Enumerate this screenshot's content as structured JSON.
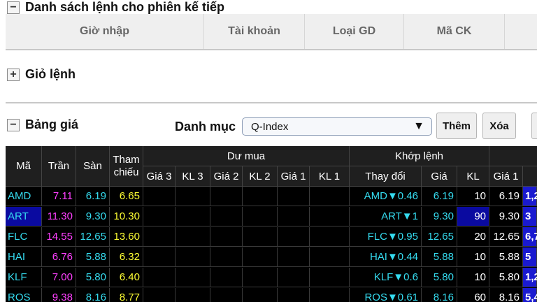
{
  "section_next": {
    "toggle": "−",
    "title": "Danh sách lệnh cho phiên kế tiếp",
    "columns": [
      "Giờ nhập",
      "Tài khoản",
      "Loại GD",
      "Mã CK"
    ]
  },
  "section_basket": {
    "toggle": "+",
    "title": "Giỏ lệnh"
  },
  "section_board": {
    "toggle": "−",
    "title": "Bảng giá",
    "category_label": "Danh mục",
    "category_value": "Q-Index",
    "select_arrow": "▼",
    "add_label": "Thêm",
    "delete_label": "Xóa"
  },
  "board": {
    "headers": {
      "symbol": "Mã",
      "ceiling": "Trần",
      "floor": "Sàn",
      "reference": "Tham chiếu",
      "bid_group": "Dư mua",
      "bid_cols": [
        "Giá 3",
        "KL 3",
        "Giá 2",
        "KL 2",
        "Giá 1",
        "KL 1"
      ],
      "match_group": "Khớp lệnh",
      "match_cols": [
        "Thay đổi",
        "Giá",
        "KL"
      ],
      "ask_price1": "Giá 1"
    },
    "rows": [
      {
        "symbol": "AMD",
        "ceiling": "7.11",
        "floor": "6.19",
        "ref": "6.65",
        "change": "AMD▼0.46",
        "price": "6.19",
        "volume": "10",
        "ask1": "6.19",
        "extra": "1,2",
        "selected": false,
        "vol_highlight": false
      },
      {
        "symbol": "ART",
        "ceiling": "11.30",
        "floor": "9.30",
        "ref": "10.30",
        "change": "ART▼1",
        "price": "9.30",
        "volume": "90",
        "ask1": "9.30",
        "extra": "3",
        "selected": true,
        "vol_highlight": true
      },
      {
        "symbol": "FLC",
        "ceiling": "14.55",
        "floor": "12.65",
        "ref": "13.60",
        "change": "FLC▼0.95",
        "price": "12.65",
        "volume": "20",
        "ask1": "12.65",
        "extra": "6,7",
        "selected": false,
        "vol_highlight": false
      },
      {
        "symbol": "HAI",
        "ceiling": "6.76",
        "floor": "5.88",
        "ref": "6.32",
        "change": "HAI▼0.44",
        "price": "5.88",
        "volume": "10",
        "ask1": "5.88",
        "extra": "5",
        "selected": false,
        "vol_highlight": false
      },
      {
        "symbol": "KLF",
        "ceiling": "7.00",
        "floor": "5.80",
        "ref": "6.40",
        "change": "KLF▼0.6",
        "price": "5.80",
        "volume": "10",
        "ask1": "5.80",
        "extra": "1,2",
        "selected": false,
        "vol_highlight": false
      },
      {
        "symbol": "ROS",
        "ceiling": "9.38",
        "floor": "8.16",
        "ref": "8.77",
        "change": "ROS▼0.61",
        "price": "8.16",
        "volume": "60",
        "ask1": "8.16",
        "extra": "5,4",
        "selected": false,
        "vol_highlight": false
      }
    ]
  },
  "colors": {
    "ceiling": "#ff40ff",
    "floor": "#35dcf0",
    "reference": "#ffff33",
    "header_bg": "#1f1f1f",
    "board_bg": "#000000",
    "selected_row": "#0a0aa0"
  }
}
